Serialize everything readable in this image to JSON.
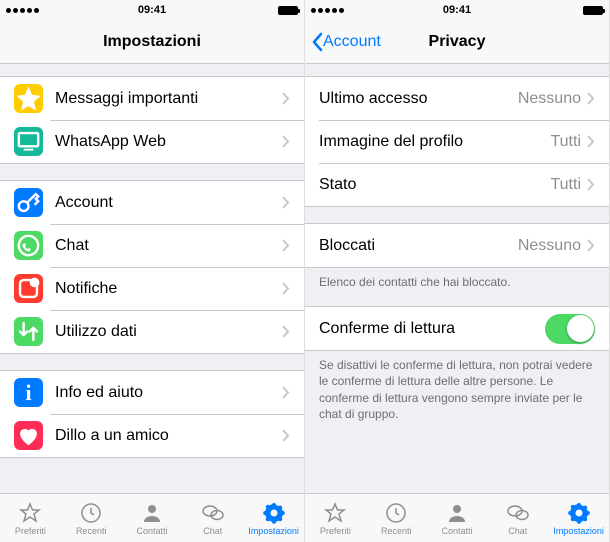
{
  "status": {
    "time": "09:41"
  },
  "left": {
    "title": "Impostazioni",
    "group1": [
      {
        "label": "Messaggi importanti"
      },
      {
        "label": "WhatsApp Web"
      }
    ],
    "group2": [
      {
        "label": "Account"
      },
      {
        "label": "Chat"
      },
      {
        "label": "Notifiche"
      },
      {
        "label": "Utilizzo dati"
      }
    ],
    "group3": [
      {
        "label": "Info ed aiuto"
      },
      {
        "label": "Dillo a un amico"
      }
    ]
  },
  "right": {
    "back": "Account",
    "title": "Privacy",
    "group1": [
      {
        "label": "Ultimo accesso",
        "value": "Nessuno"
      },
      {
        "label": "Immagine del profilo",
        "value": "Tutti"
      },
      {
        "label": "Stato",
        "value": "Tutti"
      }
    ],
    "group2": [
      {
        "label": "Bloccati",
        "value": "Nessuno"
      }
    ],
    "footer2": "Elenco dei contatti che hai bloccato.",
    "group3": [
      {
        "label": "Conferme di lettura"
      }
    ],
    "footer3": "Se disattivi le conferme di lettura, non potrai vedere le conferme di lettura delle altre persone. Le conferme di lettura vengono sempre inviate per le chat di gruppo."
  },
  "tabs": {
    "preferiti": "Preferiti",
    "recenti": "Recenti",
    "contatti": "Contatti",
    "chat": "Chat",
    "impostazioni": "Impostazioni"
  }
}
